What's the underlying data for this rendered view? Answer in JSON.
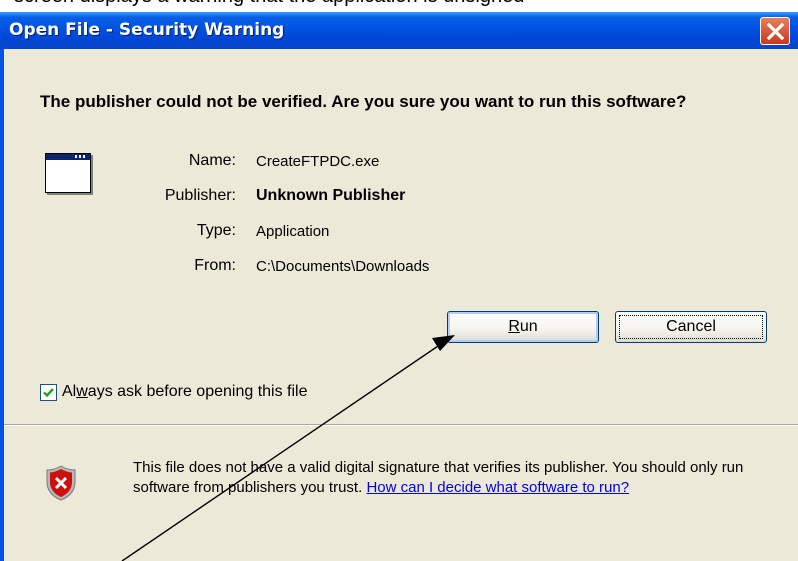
{
  "caption": "screen displays a warning that the application is unsigned",
  "dialog": {
    "title": "Open File - Security Warning",
    "header": "The publisher could not be verified.  Are you sure you want to run this software?",
    "fields": [
      {
        "label": "Name:",
        "value": "CreateFTPDC.exe",
        "bold": false
      },
      {
        "label": "Publisher:",
        "value": "Unknown Publisher",
        "bold": true
      },
      {
        "label": "Type:",
        "value": "Application",
        "bold": false
      },
      {
        "label": "From:",
        "value": "C:\\Documents\\Downloads",
        "bold": false
      }
    ],
    "buttons": {
      "run_mnemonic": "R",
      "run_rest": "un",
      "cancel": "Cancel"
    },
    "checkbox": {
      "checked": true,
      "label_pre": "Al",
      "label_mnemonic": "w",
      "label_post": "ays ask before opening this file"
    },
    "warning": {
      "text": "This file does not have a valid digital signature that verifies its publisher. You should only run software from publishers you trust.",
      "link": "How can I decide what software to run?"
    }
  },
  "colors": {
    "titlebar": "#0054e3",
    "dialog_bg": "#ece9d8",
    "close_button": "#c8391b",
    "link": "#0000ee",
    "shield": "#c00000"
  },
  "icons": {
    "close": "close-x-icon",
    "app": "application-window-icon",
    "shield": "security-shield-icon",
    "check": "checkmark-icon"
  }
}
